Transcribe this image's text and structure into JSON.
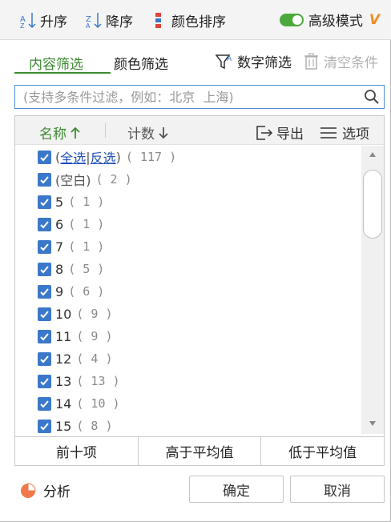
{
  "toolbar": {
    "asc_label": "升序",
    "desc_label": "降序",
    "color_sort_label": "颜色排序",
    "advanced_label": "高级模式",
    "vip_mark": "V",
    "toggle_on": true
  },
  "tabs": {
    "content_filter": "内容筛选",
    "color_filter": "颜色筛选",
    "number_filter": "数字筛选",
    "clear_filter": "清空条件"
  },
  "search": {
    "placeholder": "(支持多条件过滤，例如：北京  上海)",
    "value": ""
  },
  "panel": {
    "name_header": "名称",
    "count_header": "计数",
    "export_label": "导出",
    "options_label": "选项",
    "select_all": "全选",
    "invert": "反选",
    "open_paren": "(",
    "sep_bar": "|",
    "close_paren": ")",
    "total_count": "( 117 )",
    "items": [
      {
        "label": "(空白)",
        "count": "( 2 )"
      },
      {
        "label": "5",
        "count": "( 1 )"
      },
      {
        "label": "6",
        "count": "( 1 )"
      },
      {
        "label": "7",
        "count": "( 1 )"
      },
      {
        "label": "8",
        "count": "( 5 )"
      },
      {
        "label": "9",
        "count": "( 6 )"
      },
      {
        "label": "10",
        "count": "( 9 )"
      },
      {
        "label": "11",
        "count": "( 9 )"
      },
      {
        "label": "12",
        "count": "( 4 )"
      },
      {
        "label": "13",
        "count": "( 13 )"
      },
      {
        "label": "14",
        "count": "( 10 )"
      },
      {
        "label": "15",
        "count": "( 8 )"
      }
    ]
  },
  "quick": {
    "top10": "前十项",
    "above_avg": "高于平均值",
    "below_avg": "低于平均值"
  },
  "footer": {
    "analyze_label": "分析",
    "ok_label": "确定",
    "cancel_label": "取消"
  },
  "colors": {
    "accent_green": "#3c8a30",
    "checkbox_blue": "#3b78c9",
    "search_border": "#4a8fd6",
    "vip_orange": "#f08c22"
  }
}
